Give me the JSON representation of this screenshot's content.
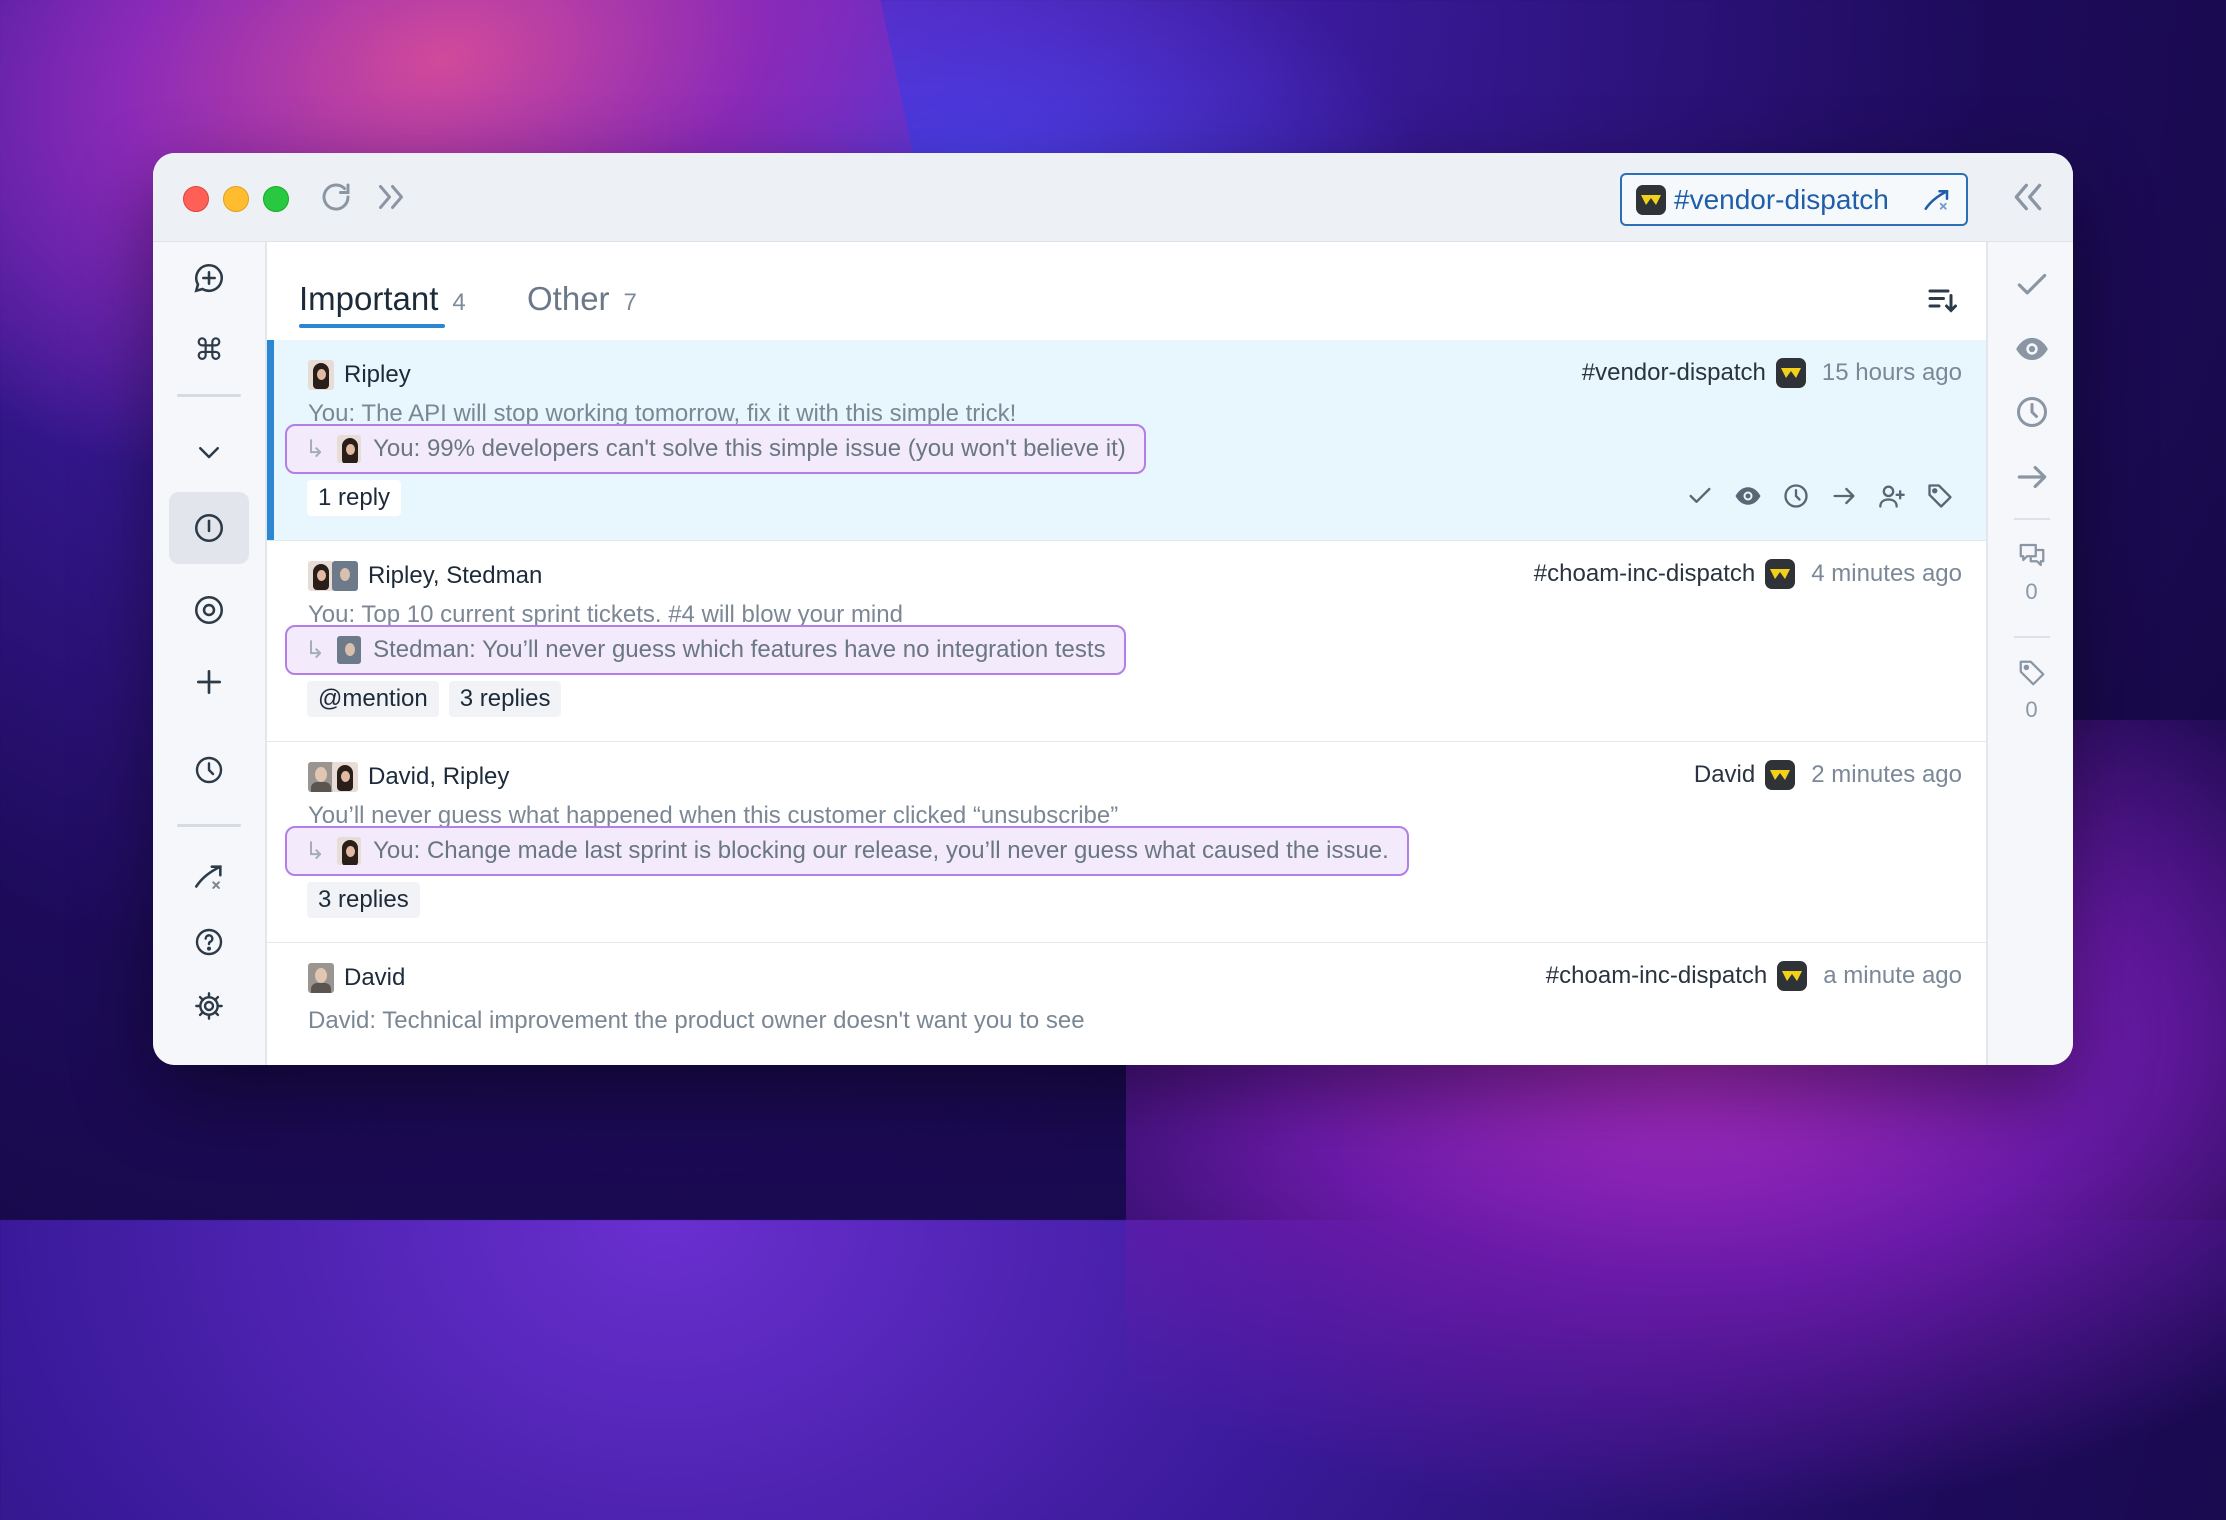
{
  "window": {
    "channel_pill": "#vendor-dispatch"
  },
  "tabs": [
    {
      "label": "Important",
      "count": "4"
    },
    {
      "label": "Other",
      "count": "7"
    }
  ],
  "rows": [
    {
      "senders": "Ripley",
      "channel": "#vendor-dispatch",
      "time": "15 hours ago",
      "preview": "You: The API will stop working tomorrow, fix it with this simple trick!",
      "quote": "You: 99% developers can't solve this simple issue (you won't believe it)",
      "tags": [
        "1 reply"
      ]
    },
    {
      "senders": "Ripley, Stedman",
      "channel": "#choam-inc-dispatch",
      "time": "4 minutes ago",
      "preview": "You: Top 10 current sprint tickets. #4 will blow your mind",
      "quote": "Stedman: You’ll never guess which features have no integration tests",
      "tags": [
        "@mention",
        "3 replies"
      ]
    },
    {
      "senders": "David, Ripley",
      "channel": "David",
      "time": "2 minutes ago",
      "preview": "You’ll never guess what happened when this customer clicked “unsubscribe”",
      "quote": "You: Change made last sprint is blocking our release, you’ll never guess what caused the issue.",
      "tags": [
        "3 replies"
      ]
    },
    {
      "senders": "David",
      "channel": "#choam-inc-dispatch",
      "time": "a minute ago",
      "preview": "David: Technical improvement the product owner doesn't want you to see"
    }
  ],
  "rightbar": {
    "comments_count": "0",
    "tags_count": "0"
  },
  "colors": {
    "accent": "#2c86d2",
    "selected_row": "#e8f6fd",
    "quote_border": "#b27ee8"
  }
}
